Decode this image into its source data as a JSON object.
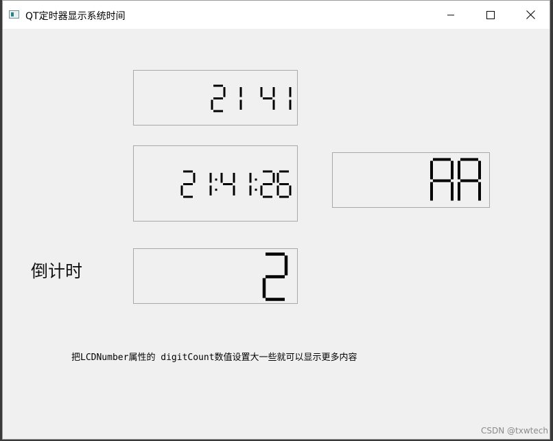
{
  "window": {
    "title": "QT定时器显示系统时间",
    "controls": {
      "minimize_icon": "minimize-icon",
      "maximize_icon": "maximize-icon",
      "close_icon": "close-icon"
    }
  },
  "lcd_displays": {
    "hour_minute": "21 41",
    "full_time": "21:41:26",
    "letters": "AA",
    "countdown": "2"
  },
  "countdown_label": "倒计时",
  "hint_text": "把LCDNumber属性的 digitCount数值设置大一些就可以显示更多内容",
  "watermark": "CSDN @txwtech",
  "colors": {
    "window_bg": "#f0f0f0",
    "titlebar_bg": "#ffffff",
    "lcd_segment": "#000000"
  }
}
